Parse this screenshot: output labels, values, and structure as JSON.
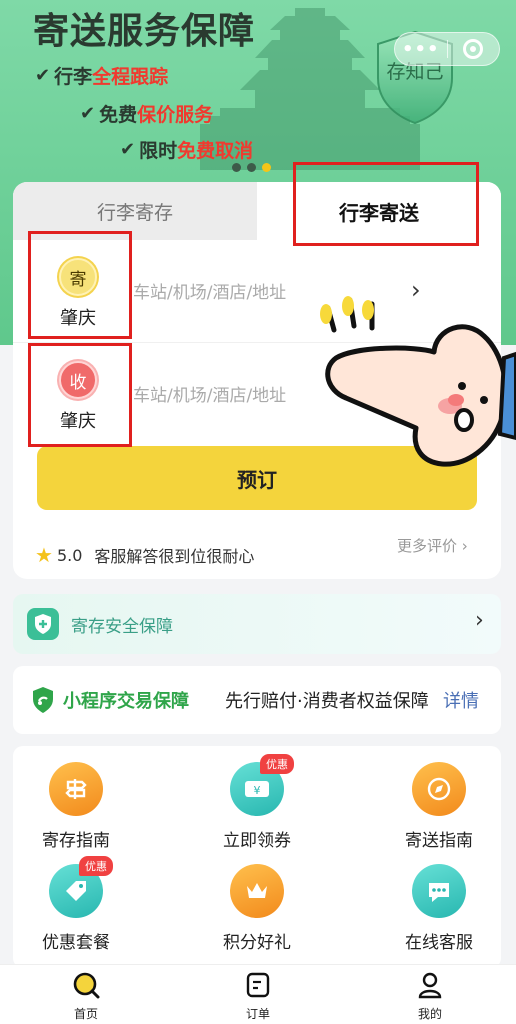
{
  "banner": {
    "title": "寄送服务保障",
    "features": [
      {
        "prefix": "行李",
        "highlight": "全程跟踪"
      },
      {
        "prefix": "免费",
        "highlight": "保价服务"
      },
      {
        "prefix": "限时",
        "highlight": "免费取消"
      }
    ],
    "shield_text": "存知己",
    "slides_total": 3,
    "slide_active": 3
  },
  "capsule": {
    "more_label": "•••"
  },
  "tabs": [
    {
      "label": "行李寄存"
    },
    {
      "label": "行李寄送"
    }
  ],
  "sender": {
    "badge": "寄",
    "city": "肇庆",
    "address_placeholder": "车站/机场/酒店/地址"
  },
  "receiver": {
    "badge": "收",
    "city": "肇庆",
    "address_placeholder": "车站/机场/酒店/地址"
  },
  "book_button": "预订",
  "rating": {
    "score": "5.0",
    "comment": "客服解答很到位很耐心",
    "more_label": "更多评价"
  },
  "security": {
    "label": "寄存安全保障"
  },
  "guarantee": {
    "title": "小程序交易保障",
    "desc": "先行赔付·消费者权益保障",
    "link": "详情"
  },
  "grid": [
    {
      "label": "寄存指南",
      "icon": "signpost-icon",
      "tag": ""
    },
    {
      "label": "立即领券",
      "icon": "coupon-icon",
      "tag": "优惠"
    },
    {
      "label": "寄送指南",
      "icon": "compass-icon",
      "tag": ""
    },
    {
      "label": "优惠套餐",
      "icon": "price-tag-icon",
      "tag": "优惠"
    },
    {
      "label": "积分好礼",
      "icon": "crown-icon",
      "tag": ""
    },
    {
      "label": "在线客服",
      "icon": "chat-icon",
      "tag": ""
    }
  ],
  "tabbar": [
    {
      "label": "首页",
      "icon": "home-search-icon"
    },
    {
      "label": "订单",
      "icon": "order-icon"
    },
    {
      "label": "我的",
      "icon": "user-icon"
    }
  ],
  "colors": {
    "banner_green": "#6ccf97",
    "highlight_red": "#f03a2f",
    "button_yellow": "#f4d43c",
    "guarantee_green": "#2fa54a",
    "link_blue": "#4a6fb5",
    "annotation_red": "#e0201e"
  }
}
